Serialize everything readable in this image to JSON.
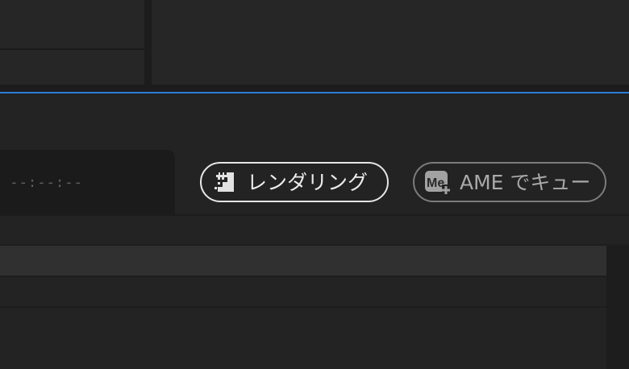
{
  "render_panel": {
    "timecode": "--:--:--",
    "render_button": {
      "label": "レンダリング",
      "icon": "render-icon"
    },
    "ame_button": {
      "label": "AME でキュー",
      "icon": "media-encoder-queue-icon",
      "icon_text": "Me"
    }
  },
  "colors": {
    "accent_line": "#2f7fd8",
    "background": "#232323",
    "render_border": "#e6e6e6",
    "ame_border": "#7c7c7c"
  }
}
